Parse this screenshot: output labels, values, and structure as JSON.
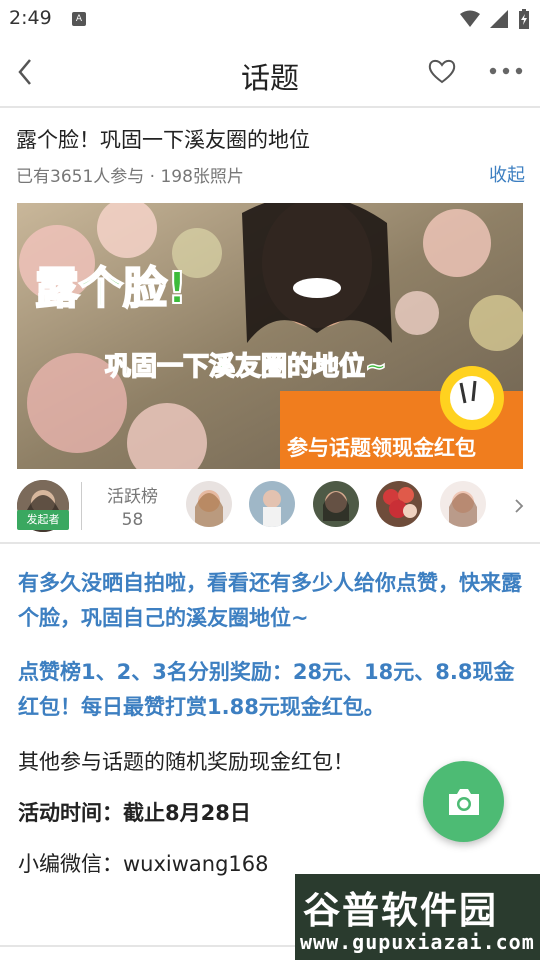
{
  "status_bar": {
    "time": "2:49",
    "notification_icon": "A"
  },
  "nav": {
    "title": "话题",
    "back_icon": "chevron-left-icon",
    "favorite_icon": "heart-outline-icon",
    "more_icon": "more-dots-icon"
  },
  "topic": {
    "title": "露个脸！巩固一下溪友圈的地位",
    "meta": "已有3651人参与 · 198张照片",
    "collapse_label": "收起"
  },
  "banner": {
    "headline": "露个脸!",
    "subline": "巩固一下溪友圈的地位~",
    "cta": "参与话题领现金红包"
  },
  "participants": {
    "sponsor_tag": "发起者",
    "active_label": "活跃榜",
    "active_count": "58"
  },
  "content": {
    "para1": "有多久没晒自拍啦，看看还有多少人给你点赞，快来露个脸，巩固自己的溪友圈地位~",
    "para2": "点赞榜1、2、3名分别奖励：28元、18元、8.8现金红包！每日最赞打赏1.88元现金红包。",
    "para3": "其他参与话题的随机奖励现金红包！",
    "para4": "活动时间：截止8月28日",
    "para5": "小编微信：wuxiwang168"
  },
  "watermark": {
    "main": "谷普软件园",
    "sub": "www.gupuxiazai.com"
  },
  "colors": {
    "accent_blue": "#3d7fc1",
    "accent_green": "#4dbb74",
    "banner_orange": "#f07d1e"
  }
}
